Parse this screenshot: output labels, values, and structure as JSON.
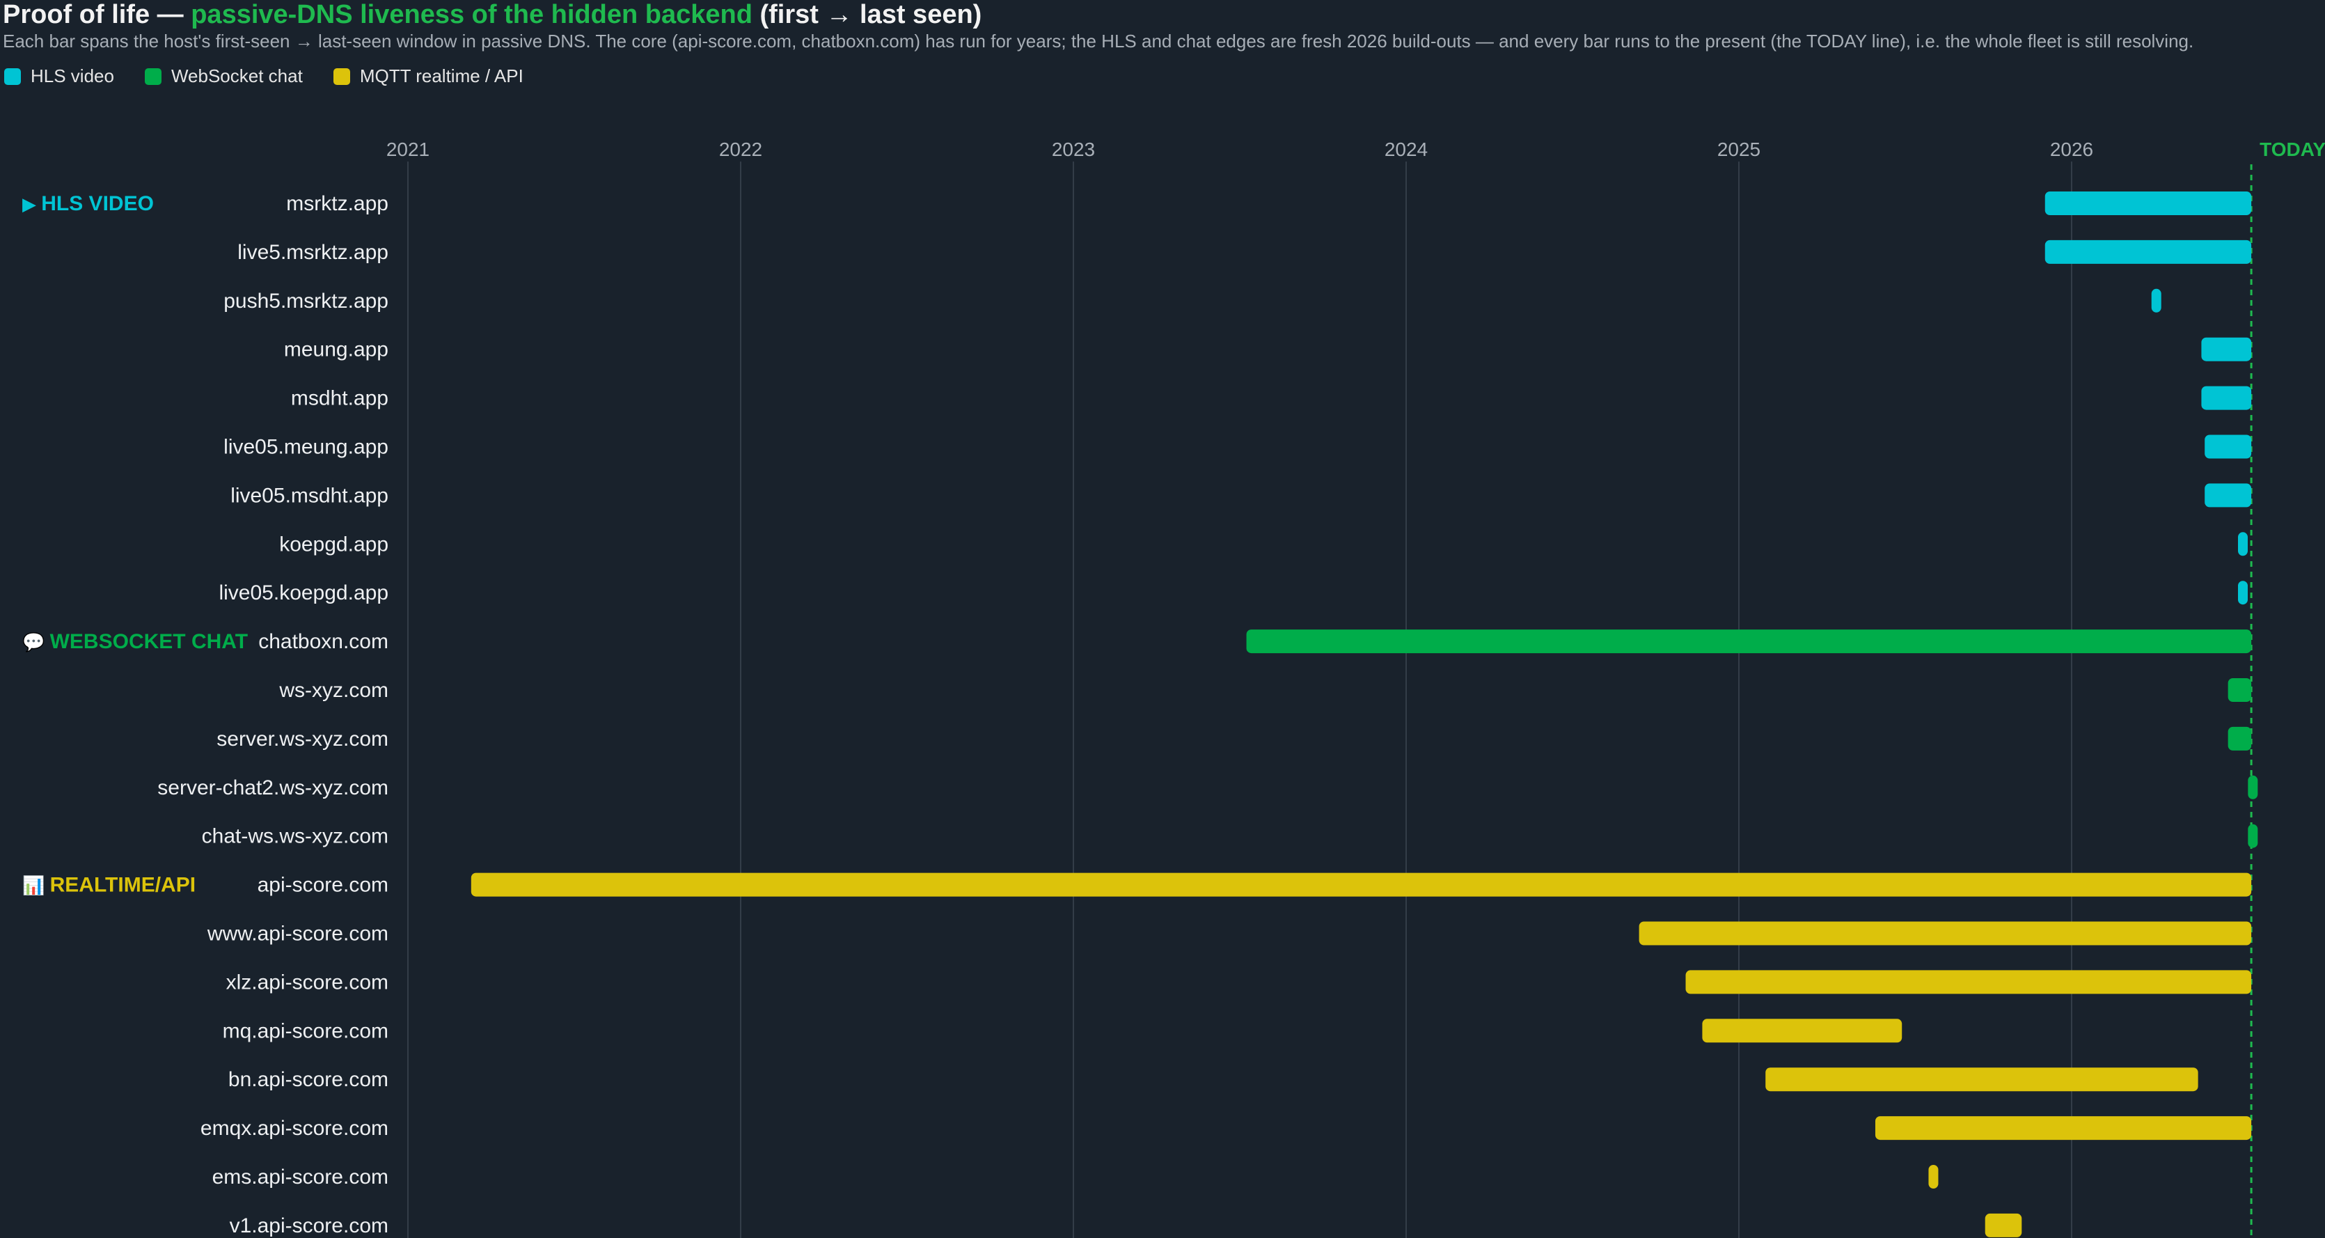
{
  "header": {
    "title_pre": "Proof of life — ",
    "title_accent": "passive-DNS liveness of the hidden backend",
    "title_post": " (first → last seen)",
    "subtitle": "Each bar spans the host's first-seen → last-seen window in passive DNS. The core (api-score.com, chatboxn.com) has run for years; the HLS and chat edges are fresh 2026 build-outs — and every bar runs to the present (the TODAY line), i.e. the whole fleet is still resolving."
  },
  "colors": {
    "hls": "#00c4d4",
    "chat": "#00ad4a",
    "mqtt": "#dcc30b",
    "today": "#1fba4f",
    "background": "#19222c",
    "grid": "#333d48"
  },
  "legend": [
    {
      "label": "HLS video",
      "color": "#00c4d4"
    },
    {
      "label": "WebSocket chat",
      "color": "#00ad4a"
    },
    {
      "label": "MQTT realtime / API",
      "color": "#dcc30b"
    }
  ],
  "chart_data": {
    "type": "gantt",
    "x_ticks": [
      "2021",
      "2022",
      "2023",
      "2024",
      "2025",
      "2026"
    ],
    "x_range": [
      2021.0,
      2026.6
    ],
    "today_label": "TODAY",
    "today": 2026.54,
    "groups": [
      {
        "label": "HLS VIDEO",
        "icon": "▶",
        "color": "#00c4d4",
        "first_row": 0
      },
      {
        "label": "WEBSOCKET CHAT",
        "icon": "💬",
        "color": "#00ad4a",
        "first_row": 9
      },
      {
        "label": "REALTIME/API",
        "icon": "📊",
        "color": "#dcc30b",
        "first_row": 14
      }
    ],
    "rows": [
      {
        "host": "msrktz.app",
        "group": "hls",
        "start": 2025.92,
        "end": 2026.54
      },
      {
        "host": "live5.msrktz.app",
        "group": "hls",
        "start": 2025.92,
        "end": 2026.54
      },
      {
        "host": "push5.msrktz.app",
        "group": "hls",
        "start": 2026.24,
        "end": 2026.25
      },
      {
        "host": "meung.app",
        "group": "hls",
        "start": 2026.39,
        "end": 2026.54
      },
      {
        "host": "msdht.app",
        "group": "hls",
        "start": 2026.39,
        "end": 2026.54
      },
      {
        "host": "live05.meung.app",
        "group": "hls",
        "start": 2026.4,
        "end": 2026.54
      },
      {
        "host": "live05.msdht.app",
        "group": "hls",
        "start": 2026.4,
        "end": 2026.54
      },
      {
        "host": "koepgd.app",
        "group": "hls",
        "start": 2026.5,
        "end": 2026.52
      },
      {
        "host": "live05.koepgd.app",
        "group": "hls",
        "start": 2026.5,
        "end": 2026.52
      },
      {
        "host": "chatboxn.com",
        "group": "chat",
        "start": 2023.52,
        "end": 2026.54
      },
      {
        "host": "ws-xyz.com",
        "group": "chat",
        "start": 2026.47,
        "end": 2026.54
      },
      {
        "host": "server.ws-xyz.com",
        "group": "chat",
        "start": 2026.47,
        "end": 2026.54
      },
      {
        "host": "server-chat2.ws-xyz.com",
        "group": "chat",
        "start": 2026.53,
        "end": 2026.54
      },
      {
        "host": "chat-ws.ws-xyz.com",
        "group": "chat",
        "start": 2026.53,
        "end": 2026.54
      },
      {
        "host": "api-score.com",
        "group": "mqtt",
        "start": 2021.19,
        "end": 2026.54
      },
      {
        "host": "www.api-score.com",
        "group": "mqtt",
        "start": 2024.7,
        "end": 2026.54
      },
      {
        "host": "xlz.api-score.com",
        "group": "mqtt",
        "start": 2024.84,
        "end": 2026.54
      },
      {
        "host": "mq.api-score.com",
        "group": "mqtt",
        "start": 2024.89,
        "end": 2025.49
      },
      {
        "host": "bn.api-score.com",
        "group": "mqtt",
        "start": 2025.08,
        "end": 2026.38
      },
      {
        "host": "emqx.api-score.com",
        "group": "mqtt",
        "start": 2025.41,
        "end": 2026.54
      },
      {
        "host": "ems.api-score.com",
        "group": "mqtt",
        "start": 2025.57,
        "end": 2025.59
      },
      {
        "host": "v1.api-score.com",
        "group": "mqtt",
        "start": 2025.74,
        "end": 2025.85
      }
    ]
  }
}
